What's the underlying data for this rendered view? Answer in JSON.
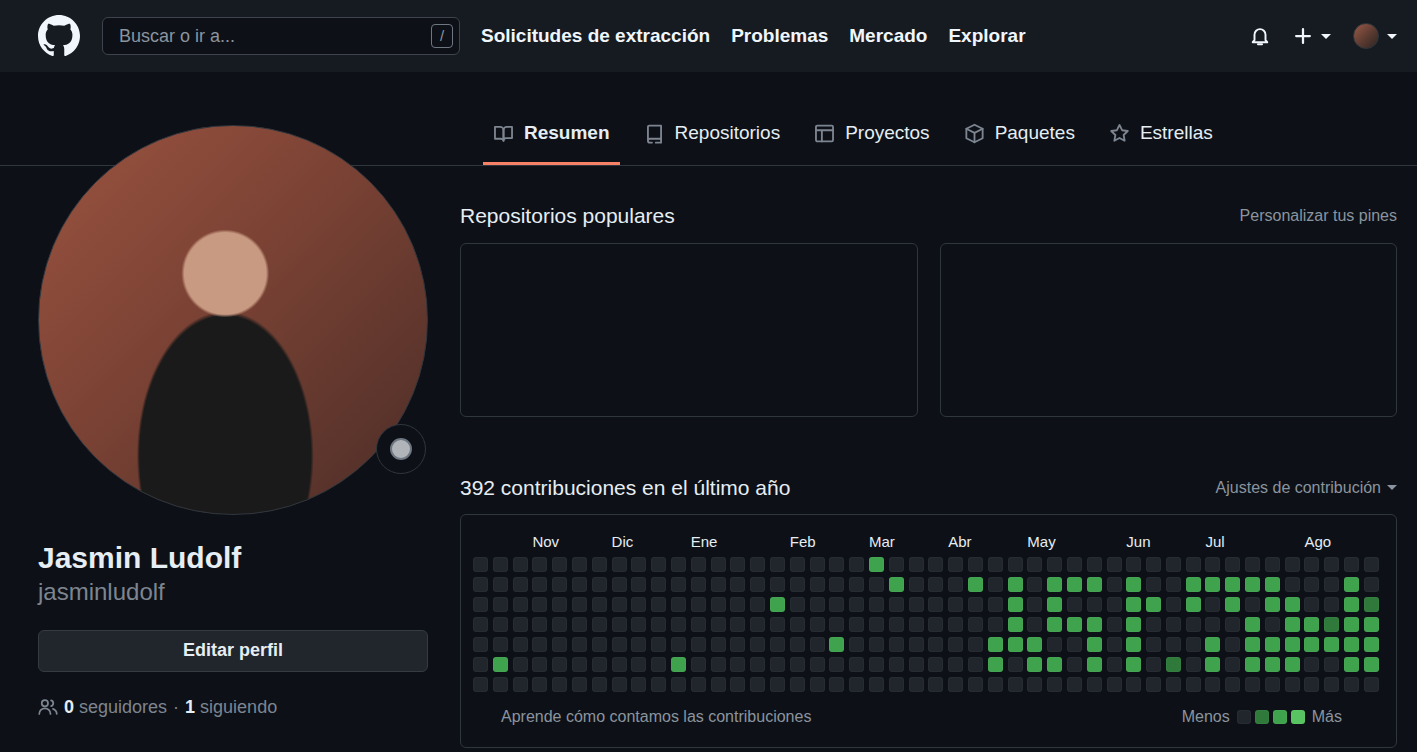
{
  "header": {
    "search": {
      "placeholder": "Buscar o ir a...",
      "shortcut": "/"
    },
    "nav": [
      "Solicitudes de extracción",
      "Problemas",
      "Mercado",
      "Explorar"
    ]
  },
  "tabs": [
    {
      "label": "Resumen",
      "selected": true
    },
    {
      "label": "Repositorios",
      "selected": false
    },
    {
      "label": "Proyectos",
      "selected": false
    },
    {
      "label": "Paquetes",
      "selected": false
    },
    {
      "label": "Estrellas",
      "selected": false
    }
  ],
  "profile": {
    "name": "Jasmin Ludolf",
    "login": "jasminludolf",
    "edit_button": "Editar perfil",
    "followers": {
      "count": "0",
      "label": "seguidores"
    },
    "separator": "·",
    "following": {
      "count": "1",
      "label": "siguiendo"
    }
  },
  "popular": {
    "title": "Repositorios populares",
    "customize": "Personalizar tus pines"
  },
  "contributions": {
    "title": "392 contribuciones en el último año",
    "settings": "Ajustes de contribución",
    "months": [
      {
        "label": "Nov",
        "week": 3
      },
      {
        "label": "Dic",
        "week": 7
      },
      {
        "label": "Ene",
        "week": 11
      },
      {
        "label": "Feb",
        "week": 16
      },
      {
        "label": "Mar",
        "week": 20
      },
      {
        "label": "Abr",
        "week": 24
      },
      {
        "label": "May",
        "week": 28
      },
      {
        "label": "Jun",
        "week": 33
      },
      {
        "label": "Jul",
        "week": 37
      },
      {
        "label": "Ago",
        "week": 42
      }
    ],
    "weeks": [
      [
        0,
        0,
        0,
        0,
        0,
        0,
        0
      ],
      [
        0,
        0,
        0,
        0,
        0,
        3,
        0
      ],
      [
        0,
        0,
        0,
        0,
        0,
        0,
        0
      ],
      [
        0,
        0,
        0,
        0,
        0,
        0,
        0
      ],
      [
        0,
        0,
        0,
        0,
        0,
        0,
        0
      ],
      [
        0,
        0,
        0,
        0,
        0,
        0,
        0
      ],
      [
        0,
        0,
        0,
        0,
        0,
        0,
        0
      ],
      [
        0,
        0,
        0,
        0,
        0,
        0,
        0
      ],
      [
        0,
        0,
        0,
        0,
        0,
        0,
        0
      ],
      [
        0,
        0,
        0,
        0,
        0,
        0,
        0
      ],
      [
        0,
        0,
        0,
        0,
        0,
        3,
        0
      ],
      [
        0,
        0,
        0,
        0,
        0,
        0,
        0
      ],
      [
        0,
        0,
        0,
        0,
        0,
        0,
        0
      ],
      [
        0,
        0,
        0,
        0,
        0,
        0,
        0
      ],
      [
        0,
        0,
        0,
        0,
        0,
        0,
        0
      ],
      [
        0,
        0,
        3,
        0,
        0,
        0,
        0
      ],
      [
        0,
        0,
        0,
        0,
        0,
        0,
        0
      ],
      [
        0,
        0,
        0,
        0,
        0,
        0,
        0
      ],
      [
        0,
        0,
        0,
        0,
        3,
        0,
        0
      ],
      [
        0,
        0,
        0,
        0,
        0,
        0,
        0
      ],
      [
        3,
        0,
        0,
        0,
        0,
        0,
        0
      ],
      [
        0,
        3,
        0,
        0,
        0,
        0,
        0
      ],
      [
        0,
        0,
        0,
        0,
        0,
        0,
        0
      ],
      [
        0,
        0,
        0,
        0,
        0,
        0,
        0
      ],
      [
        0,
        0,
        0,
        0,
        0,
        0,
        0
      ],
      [
        0,
        3,
        0,
        0,
        0,
        0,
        0
      ],
      [
        0,
        0,
        0,
        0,
        3,
        3,
        0
      ],
      [
        0,
        3,
        3,
        3,
        3,
        0,
        0
      ],
      [
        0,
        0,
        0,
        0,
        3,
        3,
        0
      ],
      [
        0,
        3,
        3,
        3,
        0,
        3,
        0
      ],
      [
        0,
        3,
        0,
        3,
        0,
        0,
        0
      ],
      [
        0,
        3,
        0,
        3,
        3,
        3,
        0
      ],
      [
        0,
        0,
        0,
        0,
        0,
        0,
        0
      ],
      [
        0,
        3,
        3,
        3,
        3,
        3,
        0
      ],
      [
        0,
        0,
        3,
        0,
        0,
        0,
        0
      ],
      [
        0,
        0,
        0,
        0,
        0,
        2,
        0
      ],
      [
        0,
        3,
        3,
        0,
        0,
        0,
        0
      ],
      [
        0,
        3,
        0,
        0,
        3,
        3,
        0
      ],
      [
        0,
        3,
        3,
        0,
        0,
        0,
        0
      ],
      [
        0,
        3,
        0,
        3,
        3,
        3,
        0
      ],
      [
        0,
        3,
        3,
        0,
        3,
        3,
        0
      ],
      [
        0,
        0,
        3,
        3,
        3,
        3,
        0
      ],
      [
        0,
        0,
        0,
        3,
        3,
        0,
        0
      ],
      [
        0,
        0,
        0,
        2,
        3,
        0,
        0
      ],
      [
        0,
        3,
        3,
        3,
        3,
        3,
        0
      ],
      [
        0,
        0,
        2,
        3,
        3,
        3,
        0
      ]
    ],
    "learn_more": "Aprende cómo contamos las contribuciones",
    "legend": {
      "less": "Menos",
      "more": "Más",
      "levels": [
        0,
        2,
        3,
        4
      ]
    }
  }
}
